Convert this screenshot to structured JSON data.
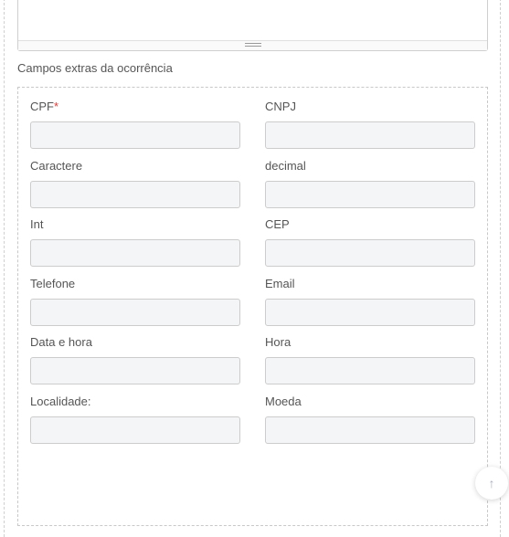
{
  "section": {
    "title": "Campos extras da ocorrência"
  },
  "fields": [
    {
      "label": "CPF",
      "required_mark": "*",
      "value": ""
    },
    {
      "label": "CNPJ",
      "value": ""
    },
    {
      "label": "Caractere",
      "value": ""
    },
    {
      "label": "decimal",
      "value": ""
    },
    {
      "label": "Int",
      "value": ""
    },
    {
      "label": "CEP",
      "value": ""
    },
    {
      "label": "Telefone",
      "value": ""
    },
    {
      "label": "Email",
      "value": ""
    },
    {
      "label": "Data e hora",
      "value": ""
    },
    {
      "label": "Hora",
      "value": ""
    },
    {
      "label": "Localidade:",
      "value": ""
    },
    {
      "label": "Moeda",
      "value": ""
    }
  ],
  "scroll_top": {
    "icon": "arrow-up-icon",
    "glyph": "↑"
  }
}
